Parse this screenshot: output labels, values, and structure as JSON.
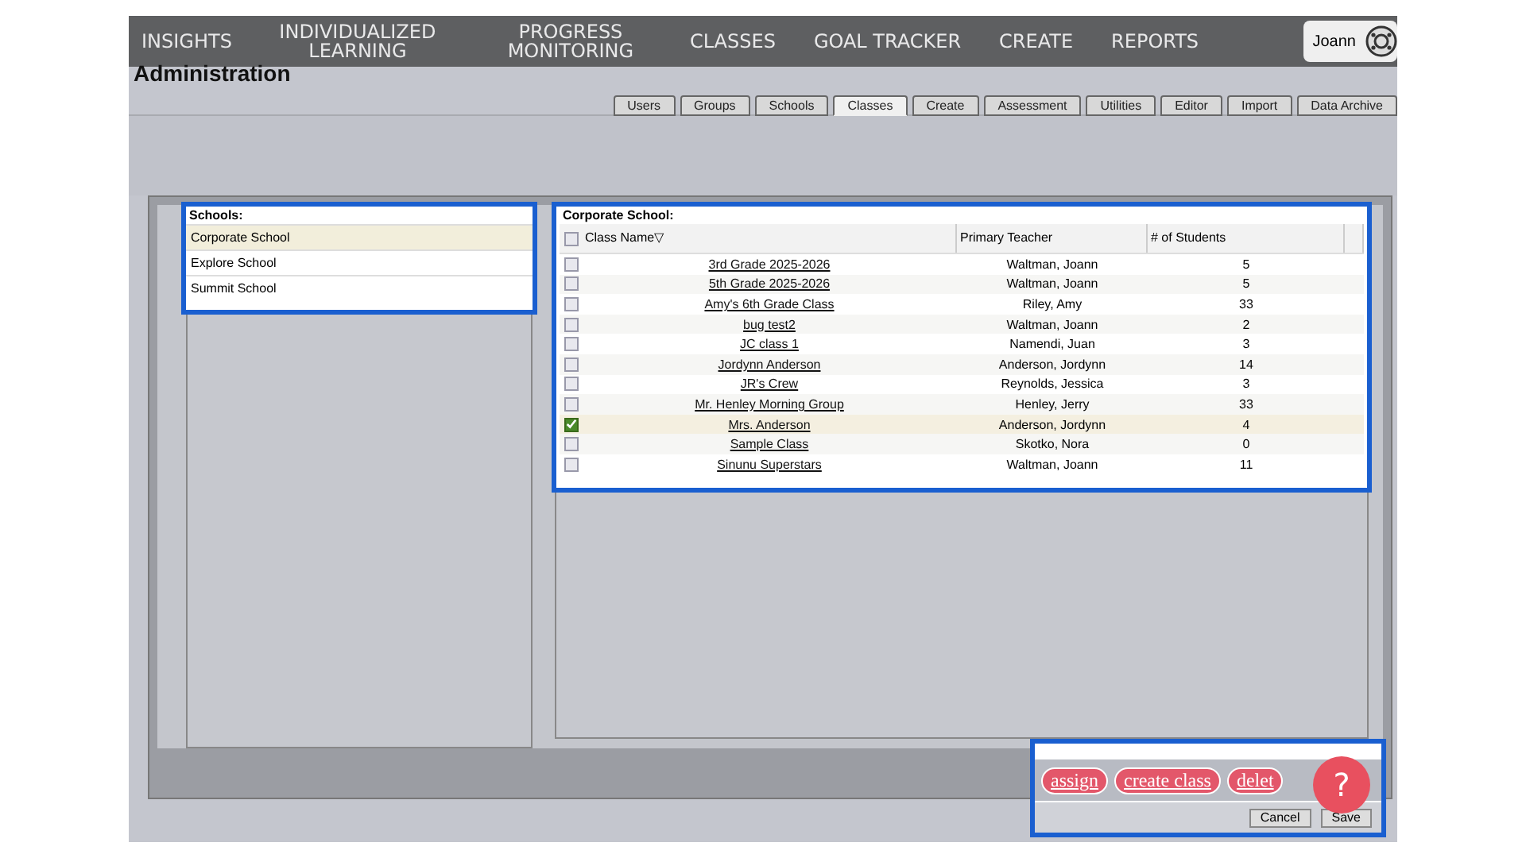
{
  "nav": {
    "items": [
      {
        "label": "INSIGHTS"
      },
      {
        "label": "INDIVIDUALIZED LEARNING"
      },
      {
        "label": "PROGRESS MONITORING"
      },
      {
        "label": "CLASSES"
      },
      {
        "label": "GOAL TRACKER"
      },
      {
        "label": "CREATE"
      },
      {
        "label": "REPORTS"
      }
    ],
    "user": "Joann"
  },
  "heading": "Administration",
  "tabs": [
    {
      "label": "Users",
      "selected": false
    },
    {
      "label": "Groups",
      "selected": false
    },
    {
      "label": "Schools",
      "selected": false
    },
    {
      "label": "Classes",
      "selected": true
    },
    {
      "label": "Create",
      "selected": false
    },
    {
      "label": "Assessment",
      "selected": false
    },
    {
      "label": "Utilities",
      "selected": false
    },
    {
      "label": "Editor",
      "selected": false
    },
    {
      "label": "Import",
      "selected": false
    },
    {
      "label": "Data Archive",
      "selected": false
    }
  ],
  "schools": {
    "title": "Schools:",
    "items": [
      {
        "name": "Corporate School",
        "selected": true
      },
      {
        "name": "Explore School",
        "selected": false
      },
      {
        "name": "Summit School",
        "selected": false
      }
    ]
  },
  "classes": {
    "title": "Corporate School:",
    "all_checked": false,
    "columns": [
      "Class Name",
      "Primary Teacher",
      "# of Students"
    ],
    "sort_mark": "▽",
    "rows": [
      {
        "name": "3rd Grade 2025-2026",
        "teacher": "Waltman, Joann",
        "students": "5",
        "checked": false
      },
      {
        "name": "5th Grade 2025-2026",
        "teacher": "Waltman, Joann",
        "students": "5",
        "checked": false
      },
      {
        "name": "Amy's 6th Grade Class",
        "teacher": "Riley, Amy",
        "students": "33",
        "checked": false
      },
      {
        "name": "bug test2",
        "teacher": "Waltman, Joann",
        "students": "2",
        "checked": false
      },
      {
        "name": "JC class 1",
        "teacher": "Namendi, Juan",
        "students": "3",
        "checked": false
      },
      {
        "name": "Jordynn Anderson",
        "teacher": "Anderson, Jordynn",
        "students": "14",
        "checked": false
      },
      {
        "name": "JR's Crew",
        "teacher": "Reynolds, Jessica",
        "students": "3",
        "checked": false
      },
      {
        "name": "Mr. Henley Morning Group",
        "teacher": "Henley, Jerry",
        "students": "33",
        "checked": false
      },
      {
        "name": "Mrs. Anderson",
        "teacher": "Anderson, Jordynn",
        "students": "4",
        "checked": true
      },
      {
        "name": "Sample Class",
        "teacher": "Skotko, Nora",
        "students": "0",
        "checked": false
      },
      {
        "name": "Sinunu Superstars",
        "teacher": "Waltman, Joann",
        "students": "11",
        "checked": false
      }
    ]
  },
  "actions": [
    "assign",
    "create class",
    "delet"
  ],
  "help": "?",
  "footer_buttons": [
    "Cancel",
    "Save"
  ]
}
